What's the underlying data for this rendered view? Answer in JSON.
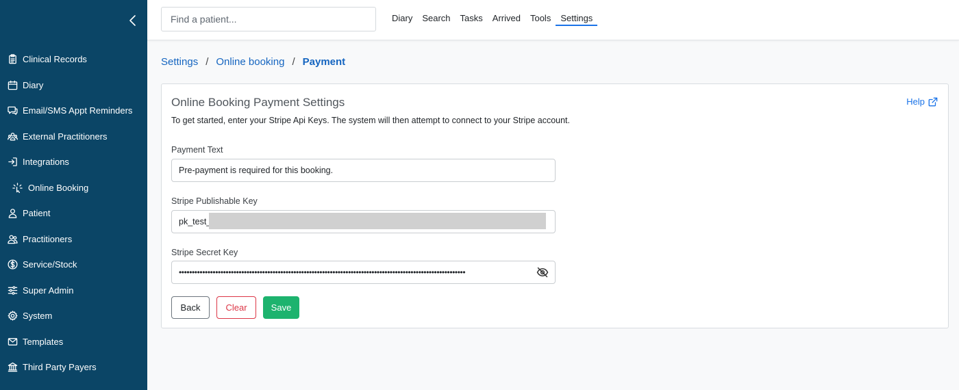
{
  "sidebar": {
    "collapse_icon": "chevron-left-icon",
    "items": [
      {
        "label": "Clinical Records",
        "icon": "clipboard-icon"
      },
      {
        "label": "Diary",
        "icon": "calendar-icon"
      },
      {
        "label": "Email/SMS Appt Reminders",
        "icon": "chat-icon"
      },
      {
        "label": "External Practitioners",
        "icon": "people-network-icon"
      },
      {
        "label": "Integrations",
        "icon": "sign-in-icon"
      },
      {
        "label": "Online Booking",
        "icon": "sparkle-click-icon"
      },
      {
        "label": "Patient",
        "icon": "person-icon"
      },
      {
        "label": "Practitioners",
        "icon": "people-icon"
      },
      {
        "label": "Service/Stock",
        "icon": "dollar-circle-icon"
      },
      {
        "label": "Super Admin",
        "icon": "sliders-icon"
      },
      {
        "label": "System",
        "icon": "gear-icon"
      },
      {
        "label": "Templates",
        "icon": "envelope-icon"
      },
      {
        "label": "Third Party Payers",
        "icon": "bank-icon"
      }
    ]
  },
  "header": {
    "search_placeholder": "Find a patient...",
    "nav": [
      "Diary",
      "Search",
      "Tasks",
      "Arrived",
      "Tools",
      "Settings"
    ],
    "active_nav": "Settings"
  },
  "breadcrumb": {
    "items": [
      "Settings",
      "Online booking"
    ],
    "current": "Payment"
  },
  "card": {
    "title": "Online Booking Payment Settings",
    "help_label": "Help",
    "intro": "To get started, enter your Stripe Api Keys. The system will then attempt to connect to your Stripe account.",
    "payment_text_label": "Payment Text",
    "payment_text_value": "Pre-payment is required for this booking.",
    "publishable_key_label": "Stripe Publishable Key",
    "publishable_key_value": "pk_test_",
    "secret_key_label": "Stripe Secret Key",
    "secret_key_value": "••••••••••••••••••••••••••••••••••••••••••••••••••••••••••••••••••••••••••••••••••••••••••••••••••••••••••••••",
    "buttons": {
      "back": "Back",
      "clear": "Clear",
      "save": "Save"
    }
  },
  "colors": {
    "sidebar_bg": "#0b4566",
    "link": "#1565c0",
    "save": "#1db36e",
    "clear": "#dc3545"
  }
}
